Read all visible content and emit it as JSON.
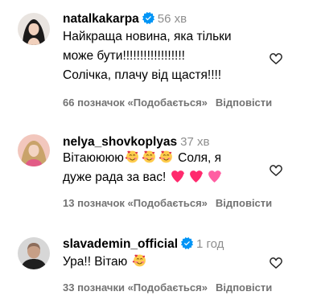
{
  "comments": [
    {
      "username": "natalkakarpa",
      "time": "56 хв",
      "verified": true,
      "lines": [
        "Найкраща новина, яка тільки",
        "може бути!!!!!!!!!!!!!!!!!!",
        "Солічка, плачу від щастя!!!!"
      ],
      "likes": "66 позначок «Подобається»",
      "reply": "Відповісти"
    },
    {
      "username": "nelya_shovkoplyas",
      "time": "37 хв",
      "verified": false,
      "line1_text_a": "Вітаюююю",
      "line1_text_b": " Соля, я",
      "line2_text": "дуже рада за вас!",
      "emoji_names": [
        "smiling-face-with-hearts",
        "red-heart",
        "pink-heart"
      ],
      "likes": "13 позначок «Подобається»",
      "reply": "Відповісти"
    },
    {
      "username": "slavademin_official",
      "time": "1 год",
      "verified": true,
      "line_text": "Ура!! Вітаю",
      "likes": "33 позначки «Подобається»",
      "reply": "Відповісти"
    }
  ],
  "colors": {
    "verified_badge": "#0095f6",
    "secondary_text": "#737373",
    "heart_emoji": "#ff2a6d"
  }
}
